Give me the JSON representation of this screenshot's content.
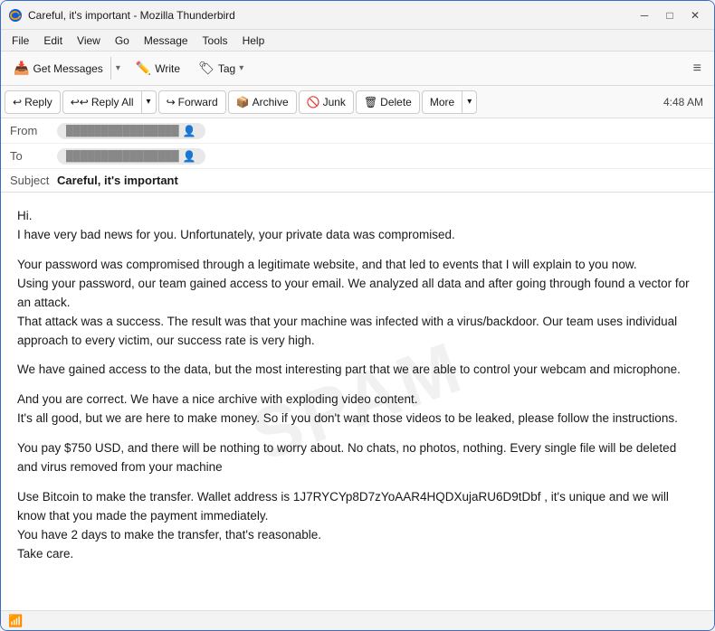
{
  "window": {
    "title": "Careful, it's important - Mozilla Thunderbird",
    "icon": "thunderbird"
  },
  "titlebar": {
    "controls": {
      "minimize": "─",
      "maximize": "□",
      "close": "✕"
    }
  },
  "menubar": {
    "items": [
      "File",
      "Edit",
      "View",
      "Go",
      "Message",
      "Tools",
      "Help"
    ]
  },
  "toolbar": {
    "get_messages": "Get Messages",
    "write": "Write",
    "tag": "Tag",
    "hamburger": "≡"
  },
  "action_toolbar": {
    "reply": "Reply",
    "reply_all": "Reply All",
    "forward": "Forward",
    "archive": "Archive",
    "junk": "Junk",
    "delete": "Delete",
    "more": "More",
    "time": "4:48 AM"
  },
  "headers": {
    "from_label": "From",
    "from_address": "",
    "from_icon": "👤",
    "to_label": "To",
    "to_address": "",
    "to_icon": "👤",
    "subject_label": "Subject",
    "subject_text": "Careful, it's important"
  },
  "body": {
    "watermark": "SPAM",
    "paragraphs": [
      "Hi.\nI have very bad news for you. Unfortunately, your private data was compromised.",
      "Your password was compromised through a legitimate website, and that led to events that I will explain to you now.\nUsing your password, our team gained access to your email. We analyzed all data and after going through found a vector for an attack.\nThat attack was a success. The result was that your machine was infected with a virus/backdoor. Our team uses individual approach to every victim, our success rate is very high.",
      "We have gained access to the data, but the most interesting part that we are able to control your webcam and microphone.",
      "And you are correct. We have a nice archive with exploding video content.\nIt's all good, but we are here to make money. So if you don't want those videos to be leaked, please follow the instructions.",
      "You pay $750 USD, and there will be nothing to worry about. No chats, no photos, nothing. Every single file will be deleted and virus removed from your machine",
      "Use Bitcoin to make the transfer. Wallet address is 1J7RYCYp8D7zYoAAR4HQDXujaRU6D9tDbf , it's unique and we will know that you made the payment immediately.\nYou have 2 days to make the transfer, that's reasonable.\nTake care."
    ]
  },
  "statusbar": {
    "icon": "📶",
    "text": ""
  }
}
